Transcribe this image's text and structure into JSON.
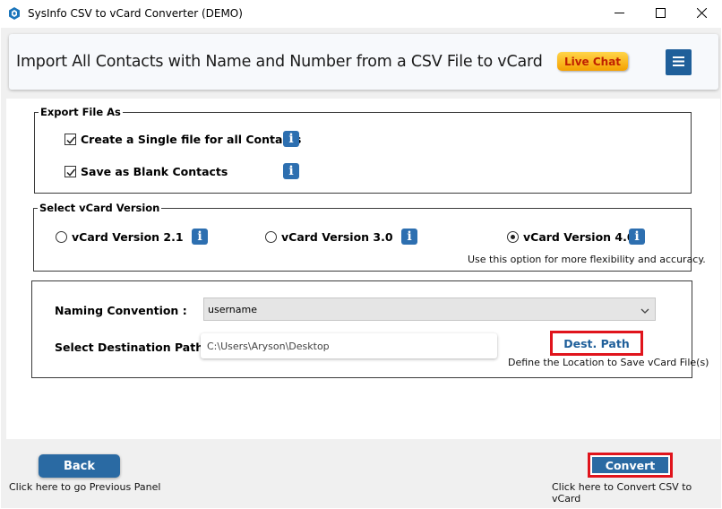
{
  "window": {
    "title": "SysInfo CSV to vCard Converter (DEMO)"
  },
  "header": {
    "title": "Import All Contacts with Name and Number from a CSV File to vCard",
    "live_chat_label": "Live Chat",
    "menu_icon": "hamburger-menu-icon"
  },
  "export_file_as": {
    "legend": "Export File As",
    "options": [
      {
        "label": "Create a Single file for all Contacts",
        "checked": true
      },
      {
        "label": "Save as Blank Contacts",
        "checked": true
      }
    ]
  },
  "vcard_version": {
    "legend": "Select vCard Version",
    "options": [
      {
        "label": "vCard Version 2.1",
        "selected": false
      },
      {
        "label": "vCard Version 3.0",
        "selected": false
      },
      {
        "label": "vCard Version 4.0",
        "selected": true
      }
    ],
    "hint": "Use this option for more flexibility and accuracy."
  },
  "settings": {
    "naming_label": "Naming Convention :",
    "naming_value": "username",
    "destination_label": "Select Destination Path :",
    "destination_value": "C:\\Users\\Aryson\\Desktop",
    "dest_button_label": "Dest. Path",
    "dest_hint": "Define the Location to Save vCard File(s)"
  },
  "footer": {
    "back_label": "Back",
    "back_hint": "Click here to go Previous Panel",
    "convert_label": "Convert",
    "convert_hint": "Click here to Convert CSV to vCard"
  },
  "colors": {
    "accent": "#2a6aa3",
    "highlight": "#e0141c"
  }
}
